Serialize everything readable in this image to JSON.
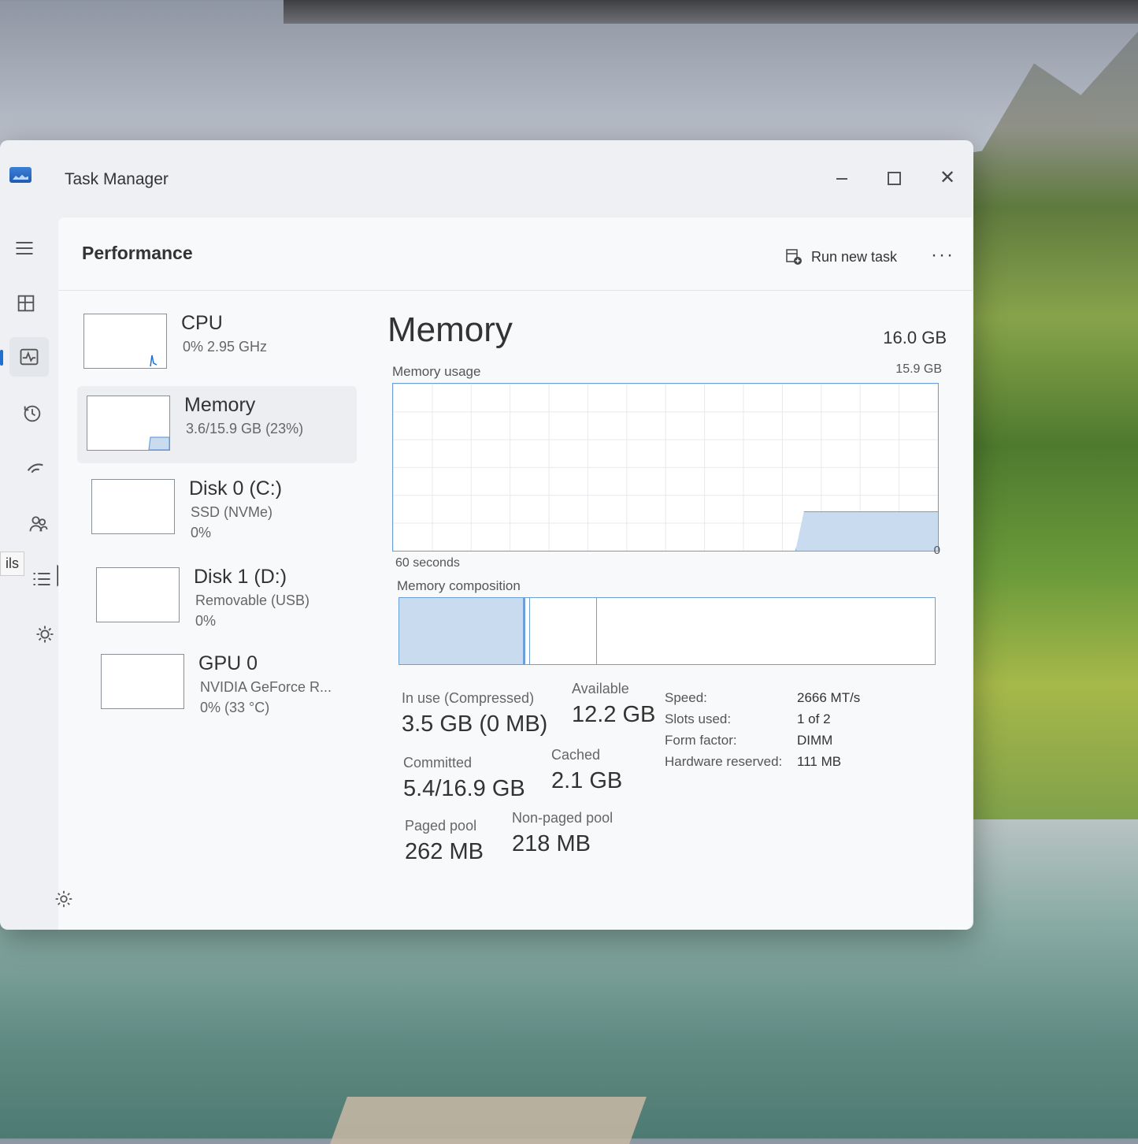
{
  "window": {
    "title": "Task Manager",
    "controls": {
      "minimize": "minimize",
      "maximize": "maximize",
      "close": "✕"
    }
  },
  "rail": {
    "tooltip": "ils",
    "items": [
      {
        "name": "hamburger-icon"
      },
      {
        "name": "processes-icon"
      },
      {
        "name": "performance-icon",
        "active": true
      },
      {
        "name": "app-history-icon"
      },
      {
        "name": "startup-apps-icon"
      },
      {
        "name": "users-icon"
      },
      {
        "name": "details-icon"
      },
      {
        "name": "services-icon"
      }
    ]
  },
  "header": {
    "page_title": "Performance",
    "run_new_task": "Run new task",
    "more": "···"
  },
  "devices": [
    {
      "name": "CPU",
      "sub1": "0%  2.95 GHz",
      "sub2": ""
    },
    {
      "name": "Memory",
      "sub1": "3.6/15.9 GB (23%)",
      "sub2": "",
      "selected": true
    },
    {
      "name": "Disk 0 (C:)",
      "sub1": "SSD (NVMe)",
      "sub2": "0%"
    },
    {
      "name": "Disk 1 (D:)",
      "sub1": "Removable (USB)",
      "sub2": "0%"
    },
    {
      "name": "GPU 0",
      "sub1": "NVIDIA GeForce R...",
      "sub2": "0%  (33 °C)"
    }
  ],
  "memory": {
    "title": "Memory",
    "total": "16.0 GB",
    "usage_label": "Memory usage",
    "usage_max": "15.9 GB",
    "axis_left": "60 seconds",
    "axis_right": "0",
    "usage_fraction": 0.23,
    "composition_label": "Memory composition",
    "composition": {
      "in_use": 0.235,
      "modified": 0.005,
      "standby": 0.125
    },
    "stats": {
      "in_use_label": "In use (Compressed)",
      "in_use_value": "3.5 GB (0 MB)",
      "available_label": "Available",
      "available_value": "12.2 GB",
      "committed_label": "Committed",
      "committed_value": "5.4/16.9 GB",
      "cached_label": "Cached",
      "cached_value": "2.1 GB",
      "paged_label": "Paged pool",
      "paged_value": "262 MB",
      "nonpaged_label": "Non-paged pool",
      "nonpaged_value": "218 MB"
    },
    "specs": [
      {
        "key": "Speed:",
        "value": "2666 MT/s"
      },
      {
        "key": "Slots used:",
        "value": "1 of 2"
      },
      {
        "key": "Form factor:",
        "value": "DIMM"
      },
      {
        "key": "Hardware reserved:",
        "value": "111 MB"
      }
    ]
  },
  "colors": {
    "accent": "#1f6fd1",
    "graph_line": "#6d9fd6",
    "graph_fill": "#c9dcef"
  }
}
